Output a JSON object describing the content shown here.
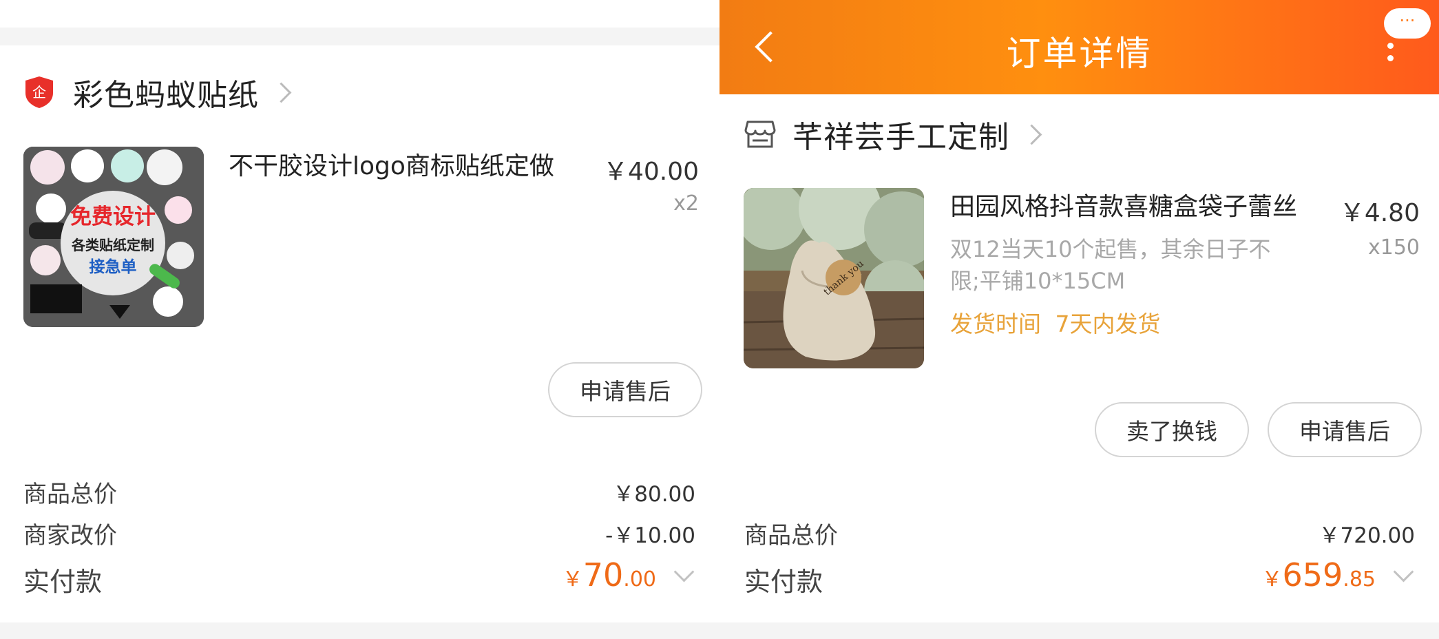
{
  "left": {
    "shop": {
      "name": "彩色蚂蚁贴纸",
      "badge_glyph": "企",
      "badge_color": "#e8302a"
    },
    "item": {
      "title": "不干胶设计logo商标贴纸定做",
      "price": "￥40.00",
      "qty": "x2",
      "thumb_text": [
        "免费设计",
        "各类贴纸定制",
        "接急单"
      ]
    },
    "buttons": {
      "after_sale": "申请售后"
    },
    "summary": {
      "goods_total_label": "商品总价",
      "goods_total_value": "￥80.00",
      "adjust_label": "商家改价",
      "adjust_value": "-￥10.00",
      "paid_label": "实付款",
      "paid_symbol": "￥",
      "paid_int": "70",
      "paid_dec": ".00"
    }
  },
  "right": {
    "header": {
      "title": "订单详情",
      "more_label": "···",
      "bg_color": "#ff8a10"
    },
    "shop": {
      "name": "芊祥芸手工定制"
    },
    "item": {
      "title": "田园风格抖音款喜糖盒袋子蕾丝",
      "price": "￥4.80",
      "qty": "x150",
      "spec_line1": "双12当天10个起售，其余日子不",
      "spec_line2": "限;平铺10*15CM",
      "ship_label": "发货时间",
      "ship_value": "7天内发货",
      "tag_text": "thank you"
    },
    "buttons": {
      "sell": "卖了换钱",
      "after_sale": "申请售后"
    },
    "summary": {
      "goods_total_label": "商品总价",
      "goods_total_value": "￥720.00",
      "paid_label": "实付款",
      "paid_symbol": "￥",
      "paid_int": "659",
      "paid_dec": ".85"
    }
  },
  "colors": {
    "accent": "#ef6a17",
    "ship_text": "#e8a33a"
  }
}
